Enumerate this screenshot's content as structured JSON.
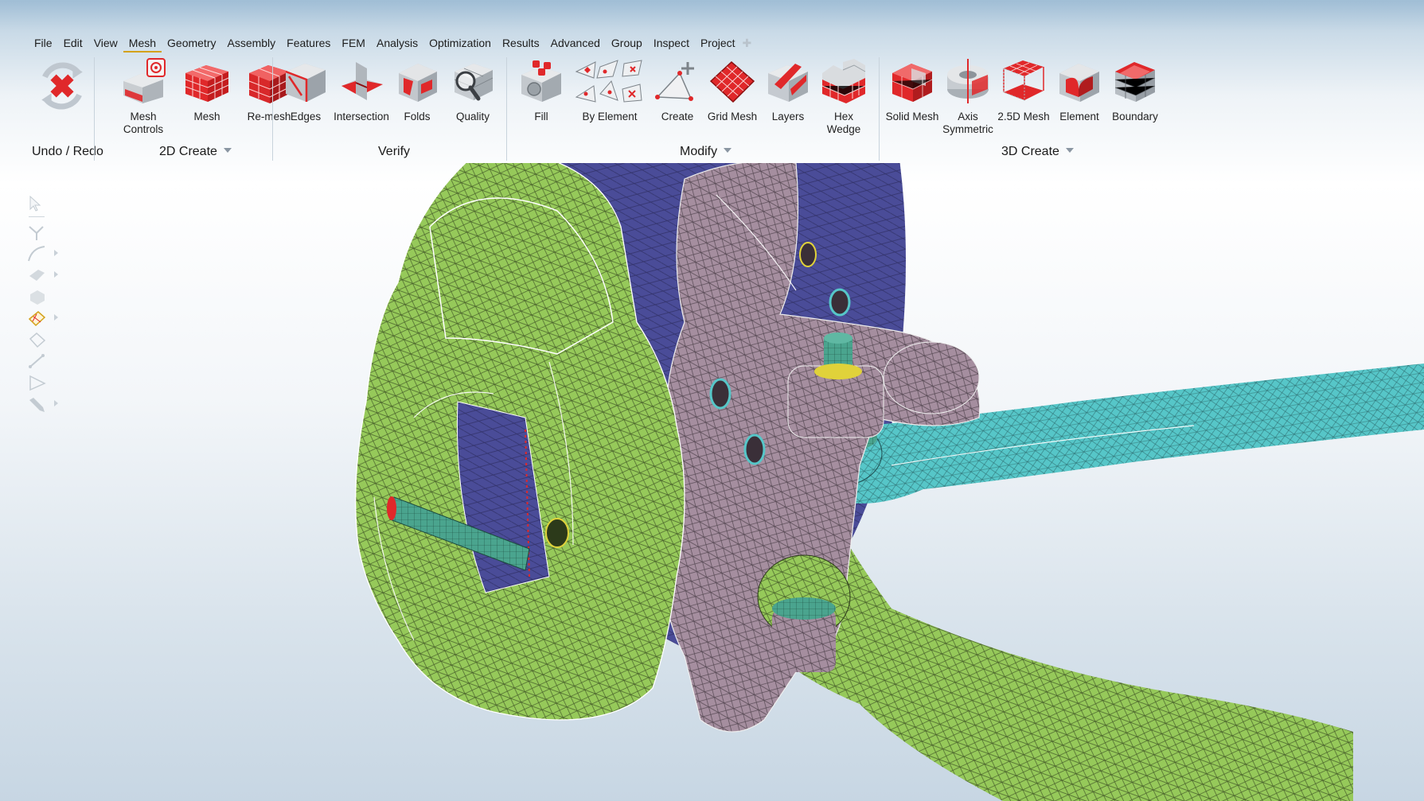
{
  "menu": [
    "File",
    "Edit",
    "View",
    "Mesh",
    "Geometry",
    "Assembly",
    "Features",
    "FEM",
    "Analysis",
    "Optimization",
    "Results",
    "Advanced",
    "Group",
    "Inspect",
    "Project"
  ],
  "active_menu": "Mesh",
  "ribbon": {
    "undo_redo": {
      "label": "Undo / Redo"
    },
    "create2d": {
      "label": "2D Create",
      "tools": [
        "Mesh\nControls",
        "Mesh",
        "Re-mesh"
      ]
    },
    "verify": {
      "label": "Verify",
      "tools": [
        "Edges",
        "Intersection",
        "Folds",
        "Quality"
      ]
    },
    "modify": {
      "label": "Modify",
      "tools": [
        "Fill",
        "By Element",
        "Create",
        "Grid Mesh",
        "Layers",
        "Hex\nWedge"
      ]
    },
    "create3d": {
      "label": "3D Create",
      "tools": [
        "Solid Mesh",
        "Axis\nSymmetric",
        "2.5D Mesh",
        "Element",
        "Boundary"
      ]
    }
  },
  "side_tools": [
    "select-arrow-icon",
    "vertex-icon",
    "curve-icon",
    "surface-icon",
    "solid-icon",
    "mesh-face-icon",
    "element-icon",
    "edge-icon",
    "triangle-icon",
    "pen-icon"
  ],
  "colors": {
    "accent": "#d4a21b",
    "mesh_red": "#e0282a",
    "caliper_green": "#96c95a",
    "rotor_blue": "#4a4c98",
    "knuckle_mauve": "#a58e9f",
    "arm_cyan": "#56c6c8"
  }
}
